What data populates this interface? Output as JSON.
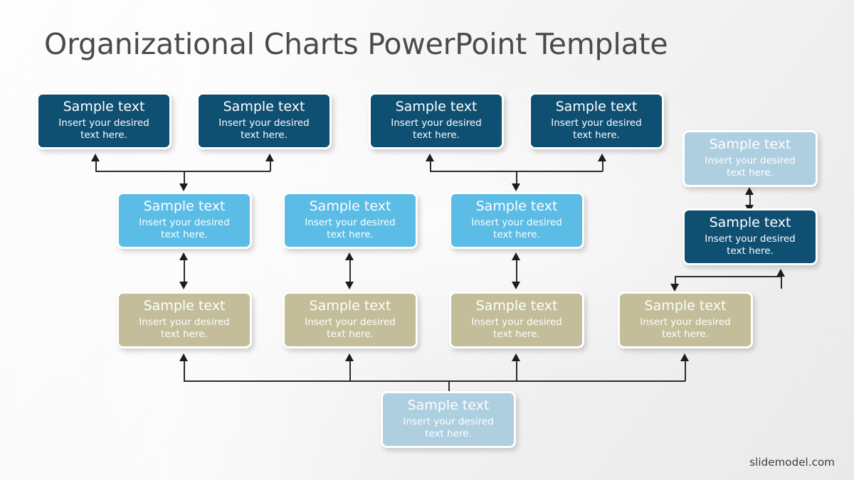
{
  "slide": {
    "title": "Organizational Charts PowerPoint Template",
    "watermark": "slidemodel.com",
    "background_color": "#f0f0f0"
  },
  "colors": {
    "navy": "#0f4f71",
    "blue": "#5bbce6",
    "tan": "#c3be99",
    "pale_blue": "#aecfe0",
    "title_text": "#4a4a4a",
    "connector": "#2b2b2b",
    "box_border": "#ffffff"
  },
  "node_text": {
    "headline": "Sample text",
    "body": "Insert your desired text here."
  },
  "rows": {
    "top": {
      "label": "top-row-navy",
      "color": "navy",
      "nodes": [
        {
          "headline": "Sample text",
          "body": "Insert your desired text here."
        },
        {
          "headline": "Sample text",
          "body": "Insert your desired text here."
        },
        {
          "headline": "Sample text",
          "body": "Insert your desired text here."
        },
        {
          "headline": "Sample text",
          "body": "Insert your desired text here."
        }
      ]
    },
    "middle": {
      "label": "middle-row-blue",
      "color": "blue",
      "nodes": [
        {
          "headline": "Sample text",
          "body": "Insert your desired text here."
        },
        {
          "headline": "Sample text",
          "body": "Insert your desired text here."
        },
        {
          "headline": "Sample text",
          "body": "Insert your desired text here."
        }
      ]
    },
    "tan": {
      "label": "tan-row",
      "color": "tan",
      "nodes": [
        {
          "headline": "Sample text",
          "body": "Insert your desired text here."
        },
        {
          "headline": "Sample text",
          "body": "Insert your desired text here."
        },
        {
          "headline": "Sample text",
          "body": "Insert your desired text here."
        },
        {
          "headline": "Sample text",
          "body": "Insert your desired text here."
        }
      ]
    },
    "right_branch": {
      "label": "right-branch",
      "nodes": [
        {
          "color": "pale_blue",
          "headline": "Sample text",
          "body": "Insert your desired text here."
        },
        {
          "color": "navy",
          "headline": "Sample text",
          "body": "Insert your desired text here."
        }
      ]
    },
    "bottom": {
      "label": "bottom-node",
      "color": "pale_blue",
      "nodes": [
        {
          "headline": "Sample text",
          "body": "Insert your desired text here."
        }
      ]
    }
  }
}
